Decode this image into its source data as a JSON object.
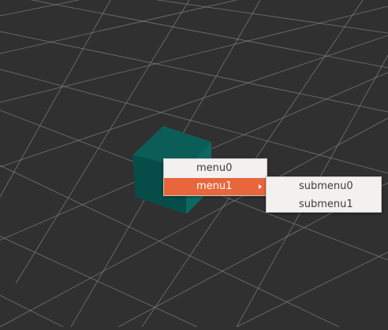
{
  "scene": {
    "background_color": "#303030",
    "grid_color": "#8a8a8a",
    "cube_colors": {
      "top": "#0b5e58",
      "left": "#064d49",
      "right": "#0d6862"
    }
  },
  "context_menu": {
    "items": [
      {
        "label": "menu0"
      },
      {
        "label": "menu1",
        "highlighted": true,
        "has_submenu": true
      }
    ],
    "highlight_color": "#e8663b"
  },
  "submenu": {
    "items": [
      {
        "label": "submenu0"
      },
      {
        "label": "submenu1"
      }
    ]
  }
}
